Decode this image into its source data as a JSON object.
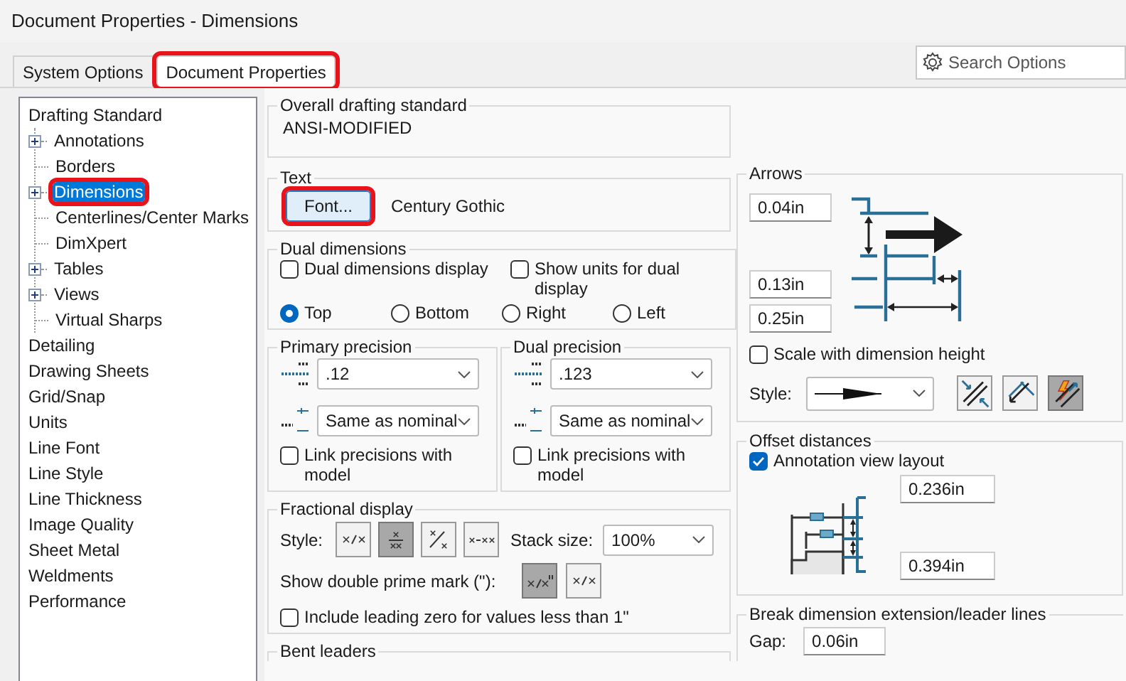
{
  "window": {
    "title": "Document Properties - Dimensions"
  },
  "tabs": [
    {
      "label": "System Options",
      "selected": false,
      "highlighted": false
    },
    {
      "label": "Document Properties",
      "selected": true,
      "highlighted": true
    }
  ],
  "search": {
    "placeholder": "Search Options"
  },
  "tree": [
    {
      "label": "Drafting Standard",
      "selected": false,
      "highlighted": false,
      "children": [
        {
          "label": "Annotations",
          "expander": true,
          "selected": false,
          "highlighted": false
        },
        {
          "label": "Borders",
          "expander": false,
          "selected": false,
          "highlighted": false
        },
        {
          "label": "Dimensions",
          "expander": true,
          "selected": true,
          "highlighted": true
        },
        {
          "label": "Centerlines/Center Marks",
          "expander": false,
          "selected": false,
          "highlighted": false
        },
        {
          "label": "DimXpert",
          "expander": false,
          "selected": false,
          "highlighted": false
        },
        {
          "label": "Tables",
          "expander": true,
          "selected": false,
          "highlighted": false
        },
        {
          "label": "Views",
          "expander": true,
          "selected": false,
          "highlighted": false
        },
        {
          "label": "Virtual Sharps",
          "expander": false,
          "selected": false,
          "highlighted": false
        }
      ]
    },
    {
      "label": "Detailing",
      "selected": false,
      "highlighted": false
    },
    {
      "label": "Drawing Sheets",
      "selected": false,
      "highlighted": false
    },
    {
      "label": "Grid/Snap",
      "selected": false,
      "highlighted": false
    },
    {
      "label": "Units",
      "selected": false,
      "highlighted": false
    },
    {
      "label": "Line Font",
      "selected": false,
      "highlighted": false
    },
    {
      "label": "Line Style",
      "selected": false,
      "highlighted": false
    },
    {
      "label": "Line Thickness",
      "selected": false,
      "highlighted": false
    },
    {
      "label": "Image Quality",
      "selected": false,
      "highlighted": false
    },
    {
      "label": "Sheet Metal",
      "selected": false,
      "highlighted": false
    },
    {
      "label": "Weldments",
      "selected": false,
      "highlighted": false
    },
    {
      "label": "Performance",
      "selected": false,
      "highlighted": false
    }
  ],
  "overall": {
    "title": "Overall drafting standard",
    "value": "ANSI-MODIFIED"
  },
  "text": {
    "title": "Text",
    "button": "Font...",
    "button_highlighted": true,
    "font": "Century Gothic"
  },
  "dual": {
    "title": "Dual dimensions",
    "checkboxes": [
      {
        "label": "Dual dimensions display",
        "checked": false
      },
      {
        "label": "Show units for dual display",
        "checked": false
      }
    ],
    "positions": [
      {
        "label": "Top",
        "selected": true
      },
      {
        "label": "Bottom",
        "selected": false
      },
      {
        "label": "Right",
        "selected": false
      },
      {
        "label": "Left",
        "selected": false
      }
    ]
  },
  "precision": [
    {
      "title": "Primary precision",
      "value": ".12",
      "tolerance": "Same as nominal",
      "link": {
        "label": "Link precisions with model",
        "checked": false
      }
    },
    {
      "title": "Dual precision",
      "value": ".123",
      "tolerance": "Same as nominal",
      "link": {
        "label": "Link precisions with model",
        "checked": false
      }
    }
  ],
  "fractional": {
    "title": "Fractional display",
    "style_label": "Style:",
    "styles": [
      {
        "kind": "slash",
        "selected": false
      },
      {
        "kind": "stacked",
        "selected": true
      },
      {
        "kind": "diagonal",
        "selected": false
      },
      {
        "kind": "dash",
        "selected": false
      }
    ],
    "stack_label": "Stack size:",
    "stack_size": "100%",
    "prime_label": "Show double prime mark (\"):",
    "prime_options": [
      {
        "kind": "prime",
        "selected": true
      },
      {
        "kind": "slash",
        "selected": false
      }
    ],
    "leading_zero": {
      "label": "Include leading zero for values less than 1\"",
      "checked": false
    }
  },
  "bent": {
    "title": "Bent leaders"
  },
  "arrows": {
    "title": "Arrows",
    "sizes": [
      "0.04in",
      "0.13in",
      "0.25in"
    ],
    "scale": {
      "label": "Scale with dimension height",
      "checked": false
    },
    "style_label": "Style:",
    "placement": [
      {
        "kind": "inside",
        "selected": false
      },
      {
        "kind": "outside",
        "selected": false
      },
      {
        "kind": "smart",
        "selected": true
      }
    ]
  },
  "offset": {
    "title": "Offset distances",
    "layout": {
      "label": "Annotation view layout",
      "checked": true
    },
    "distances": [
      "0.236in",
      "0.394in"
    ]
  },
  "break": {
    "title": "Break dimension extension/leader lines",
    "gap_label": "Gap:",
    "gap": "0.06in"
  }
}
